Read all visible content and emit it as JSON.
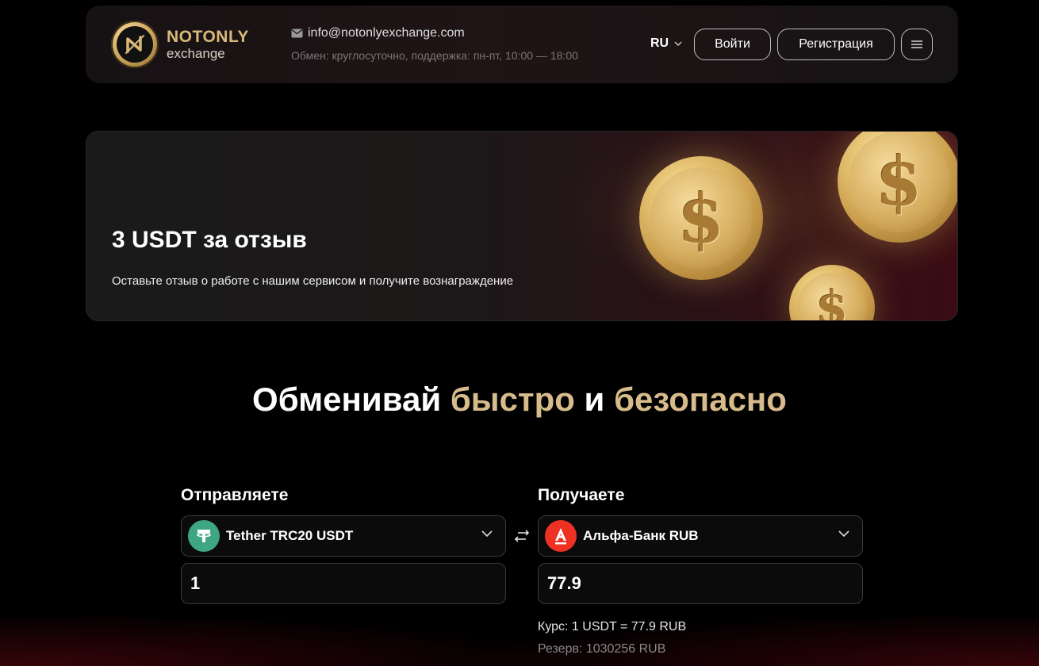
{
  "header": {
    "logo_top": "NOTONLY",
    "logo_bottom": "exchange",
    "email": "info@notonlyexchange.com",
    "hours": "Обмен: круглосуточно, поддержка: пн-пт, 10:00 — 18:00",
    "lang": "RU",
    "login_label": "Войти",
    "register_label": "Регистрация",
    "menu_icon": "hamburger-icon"
  },
  "banner": {
    "title": "3 USDT за отзыв",
    "subtitle": "Оставьте отзыв о работе с нашим сервисом и получите вознаграждение",
    "coin_symbol": "$"
  },
  "hero": {
    "part1": "Обменивай ",
    "part2": "быстро",
    "part3": " и ",
    "part4": "безопасно"
  },
  "exchange": {
    "send_label": "Отправляете",
    "receive_label": "Получаете",
    "send_currency": "Tether TRC20 USDT",
    "receive_currency": "Альфа-Банк RUB",
    "send_amount": "1",
    "receive_amount": "77.9",
    "rate": "Курс: 1 USDT = 77.9 RUB",
    "reserve": "Резерв: 1030256 RUB",
    "send_icon_color": "#3fa684",
    "receive_icon_color": "#ef3124"
  },
  "colors": {
    "accent_gold": "#d7bb8b",
    "background": "#000000"
  }
}
